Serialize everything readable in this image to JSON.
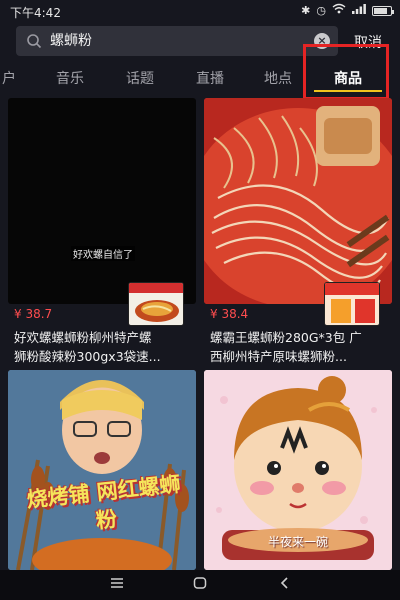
{
  "status_bar": {
    "time": "下午4:42",
    "icons": [
      "bluetooth-icon",
      "alarm-icon",
      "wifi-icon",
      "signal-icon",
      "battery-icon"
    ]
  },
  "search": {
    "query": "螺蛳粉",
    "cancel_label": "取消"
  },
  "tabs": [
    {
      "label": "户",
      "active": false
    },
    {
      "label": "音乐",
      "active": false
    },
    {
      "label": "话题",
      "active": false
    },
    {
      "label": "直播",
      "active": false
    },
    {
      "label": "地点",
      "active": false
    },
    {
      "label": "商品",
      "active": true
    }
  ],
  "products": [
    {
      "price": "¥ 38.7",
      "title_line1": "好欢螺螺蛳粉柳州特产螺",
      "title_line2": "狮粉酸辣粉300gx3袋速..."
    },
    {
      "price": "¥ 38.4",
      "title_line1": "螺霸王螺蛳粉280G*3包 广",
      "title_line2": "西柳州特产原味螺狮粉..."
    },
    {
      "overlay_text": "烧烤铺 网红螺蛳粉"
    },
    {
      "overlay_text": "半夜来一碗"
    }
  ],
  "video_caption": "好欢螺自信了",
  "colors": {
    "background": "#16171f",
    "accent": "#f0c31d",
    "price": "#ff4d4f",
    "highlight": "#e52424"
  }
}
